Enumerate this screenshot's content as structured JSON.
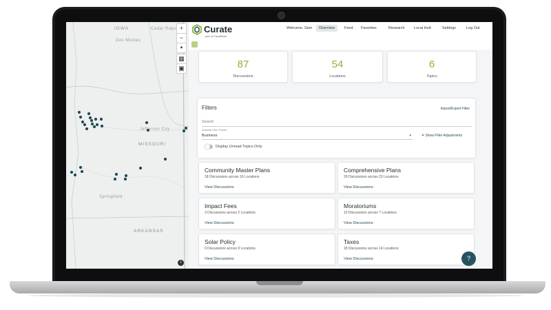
{
  "map": {
    "labels": {
      "iowa": "IOWA",
      "cedar_rapids": "Cedar Rapids",
      "des_moines": "Des Moines",
      "jefferson_city": "Jefferson City",
      "missouri": "MISSOURI",
      "springfield": "Springfield",
      "arkansas": "ARKANSAS"
    },
    "controls": {
      "zoom_in": "+",
      "zoom_out": "−",
      "compass": "▲",
      "info": "i"
    },
    "marker_color": "#1f4b57"
  },
  "header": {
    "logo_text": "Curate",
    "logo_sub": "part of FiscalNote",
    "greeting": "Welcome, Sam",
    "nav": [
      "Overview",
      "Feed",
      "Favorites",
      "Research",
      "Local Hub",
      "Settings",
      "Log Out"
    ],
    "active_nav": "Overview"
  },
  "stats": [
    {
      "value": "87",
      "label": "Discussions"
    },
    {
      "value": "54",
      "label": "Locations"
    },
    {
      "value": "6",
      "label": "Topics"
    }
  ],
  "filters": {
    "title": "Filters",
    "import_export": "Import/Export Filter",
    "search_placeholder": "Search",
    "profile_label": "Available Filter Profiles",
    "profile_value": "Business",
    "show_adjustments": "Show Filter Adjustments",
    "toggle_label": "Display Unread Topics Only"
  },
  "topics": [
    {
      "title": "Community Master Plans",
      "sub": "18 Discussions across 16 Locations",
      "link": "View Discussions"
    },
    {
      "title": "Comprehensive Plans",
      "sub": "29 Discussions across 23 Locations",
      "link": "View Discussions"
    },
    {
      "title": "Impact Fees",
      "sub": "3 Discussions across 2 Locations",
      "link": "View Discussions"
    },
    {
      "title": "Moratoriums",
      "sub": "10 Discussions across 7 Locations",
      "link": "View Discussions"
    },
    {
      "title": "Solar Policy",
      "sub": "9 Discussions across 9 Locations",
      "link": "View Discussions"
    },
    {
      "title": "Taxes",
      "sub": "18 Discussions across 14 Locations",
      "link": "View Discussions"
    }
  ],
  "help": "?",
  "colors": {
    "accent_green": "#8cb43b",
    "dark_teal": "#27535f"
  }
}
